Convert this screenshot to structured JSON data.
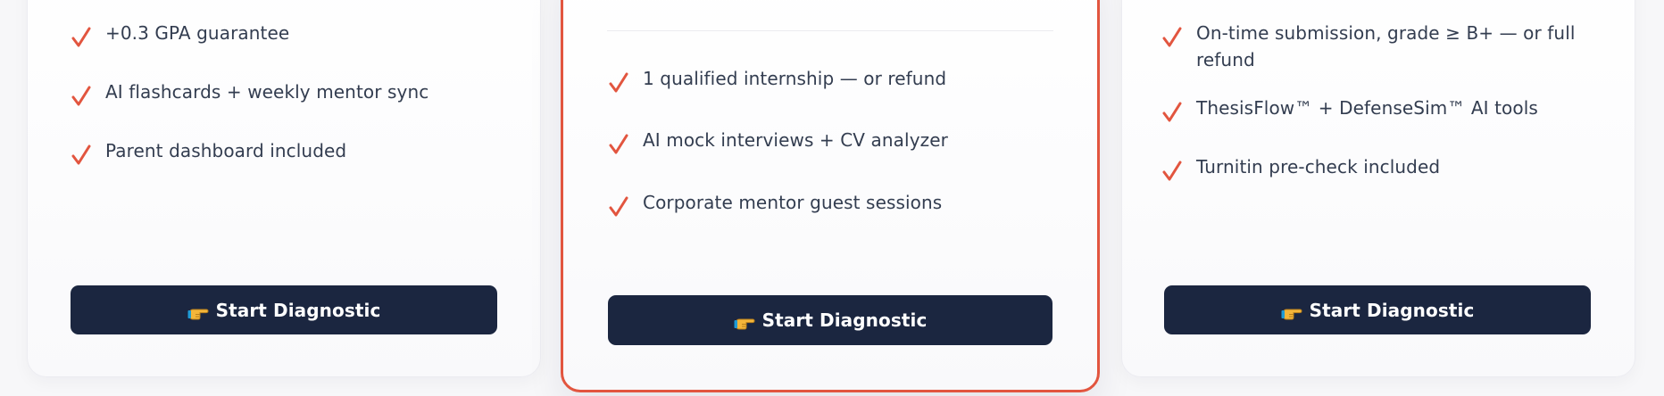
{
  "colors": {
    "accent": "#e2553f",
    "button_bg": "#1b2640",
    "button_text": "#ffffff",
    "text": "#333d50"
  },
  "icons": {
    "check": "check-icon",
    "cta": "pointing-hand-icon"
  },
  "plans": [
    {
      "features": [
        "+0.3 GPA guarantee",
        "AI flashcards + weekly mentor sync",
        "Parent dashboard included"
      ],
      "cta_label": "Start Diagnostic"
    },
    {
      "features": [
        "1 qualified internship — or refund",
        "AI mock interviews + CV analyzer",
        "Corporate mentor guest sessions"
      ],
      "cta_label": "Start Diagnostic"
    },
    {
      "features": [
        "On-time submission, grade ≥ B+ — or full refund",
        "ThesisFlow™ + DefenseSim™ AI tools",
        "Turnitin pre-check included"
      ],
      "cta_label": "Start Diagnostic"
    }
  ]
}
